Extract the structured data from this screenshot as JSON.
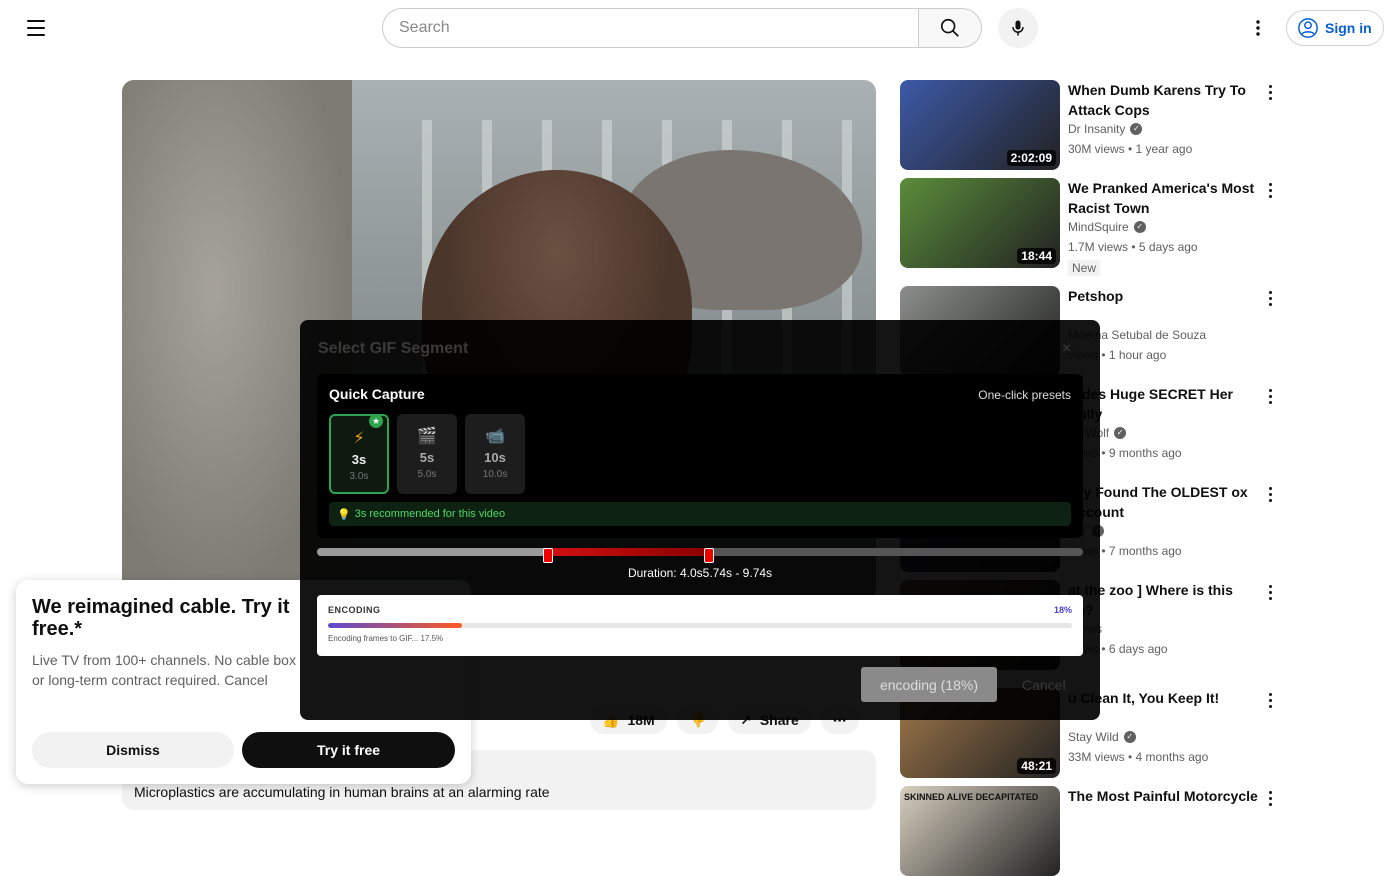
{
  "header": {
    "search_placeholder": "Search",
    "signin_label": "Sign in"
  },
  "video_actions": {
    "likes": "18M",
    "share_label": "Share"
  },
  "description": {
    "text": "Microplastics are accumulating in human brains at an alarming rate"
  },
  "sidebar": {
    "items": [
      {
        "title": "When Dumb Karens Try To Attack Cops",
        "channel": "Dr Insanity",
        "meta": "30M views • 1 year ago",
        "duration": "2:02:09",
        "verified": true,
        "thumb_color": "#3d5aa8"
      },
      {
        "title": "We Pranked America's Most Racist Town",
        "channel": "MindSquire",
        "meta": "1.7M views • 5 days ago",
        "duration": "18:44",
        "badge": "New",
        "verified": true,
        "thumb_color": "#5a8d3a"
      },
      {
        "title": "Petshop",
        "channel": "Moema Setubal de Souza",
        "meta": "views • 1 hour ago",
        "verified": false,
        "thumb_color": "#8b8f8a"
      },
      {
        "title": "Hides Huge SECRET Her Bully",
        "channel": "perWolf",
        "meta": "views • 9 months ago",
        "verified": true,
        "thumb_color": "#6c5a4a"
      },
      {
        "title": "ally Found The OLDEST ox Account",
        "channel": "erV",
        "meta": "views • 7 months ago",
        "verified": true,
        "thumb_color": "#4a4a6a"
      },
      {
        "title": "at the zoo ] Where is this on?",
        "channel": "shows",
        "meta": "views • 6 days ago",
        "verified": false,
        "thumb_color": "#7a6a50"
      },
      {
        "title": "u Clean It, You Keep It!",
        "channel": "Stay Wild",
        "meta": "33M views • 4 months ago",
        "duration": "48:21",
        "verified": true,
        "thumb_color": "#a0784a"
      },
      {
        "title": "The Most Painful Motorcycle",
        "channel": "",
        "meta": "",
        "verified": false,
        "thumb_color": "#d8d0c0",
        "thumb_text": "SKINNED ALIVE DECAPITATED"
      }
    ]
  },
  "ad": {
    "title": "We reimagined cable. Try it free.*",
    "body": "Live TV from 100+ channels. No cable box or long-term contract required. Cancel anytime.",
    "dismiss_label": "Dismiss",
    "cta_label": "Try it free"
  },
  "gif_modal": {
    "title": "Select GIF Segment",
    "close": "×",
    "quick_capture_title": "Quick Capture",
    "quick_capture_sub": "One-click presets",
    "presets": [
      {
        "icon": "⚡",
        "label": "3s",
        "sub": "3.0s",
        "active": true
      },
      {
        "icon": "🎬",
        "label": "5s",
        "sub": "5.0s",
        "active": false
      },
      {
        "icon": "📹",
        "label": "10s",
        "sub": "10.0s",
        "active": false
      }
    ],
    "recommendation": "3s recommended for this video",
    "duration_text": "Duration: 4.0s5.74s - 9.74s",
    "encoding_label": "ENCODING",
    "encoding_pct": "18%",
    "encoding_progress": 0.18,
    "encoding_note": "Encoding frames to GIF... 17.5%",
    "encode_button": "encoding (18%)",
    "cancel_button": "Cancel"
  }
}
